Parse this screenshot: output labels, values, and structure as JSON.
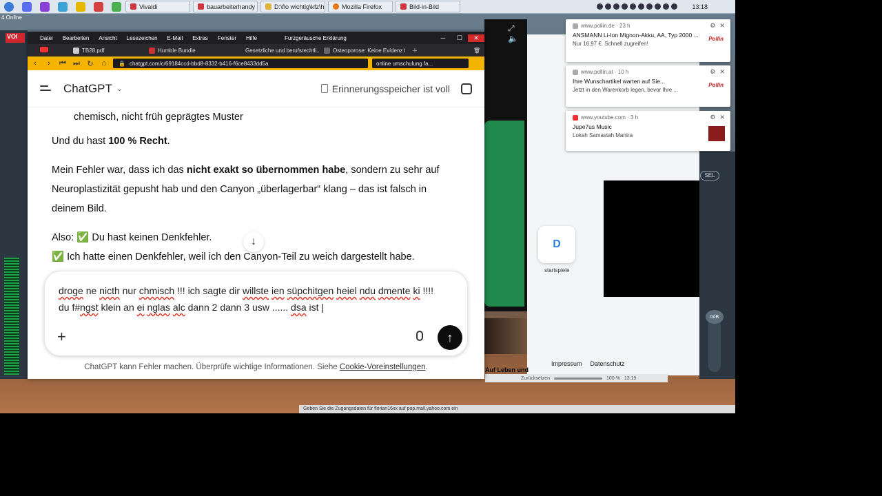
{
  "taskbar": {
    "online": "4 Online",
    "tabs": [
      {
        "label": "Vivaldi",
        "kind": "vivaldi"
      },
      {
        "label": "bauarbeiterhandy - ...",
        "kind": "vivaldi"
      },
      {
        "label": "D:\\flo wichtig\\kfz\\h...",
        "kind": "folder"
      },
      {
        "label": "Mozilla Firefox",
        "kind": "ff"
      },
      {
        "label": "Bild-in-Bild",
        "kind": "vivaldi"
      }
    ],
    "clock": "13:18"
  },
  "browser": {
    "menu": [
      "Datei",
      "Bearbeiten",
      "Ansicht",
      "Lesezeichen",
      "E-Mail",
      "Extras",
      "Fenster",
      "Hilfe"
    ],
    "window_title": "Furzgeräusche Erklärung",
    "tabs": [
      "TB28.pdf",
      "Humble Bundle",
      "Gesetzliche und berufsrechtli...",
      "Osteoporose: Keine Evidenz f..."
    ],
    "url": "chatgpt.com/c/69184ccd-bbd8-8332-b416-f6ce8433dd5a",
    "search": "online umschulung fa..."
  },
  "chat": {
    "model": "ChatGPT",
    "memory_status": "Erinnerungsspeicher ist voll",
    "bullet_text": "chemisch, nicht früh geprägtes Muster",
    "p1_a": "Und du hast ",
    "p1_b": "100 % Recht",
    "p1_c": ".",
    "p2_a": "Mein Fehler war, dass ich das ",
    "p2_b": "nicht exakt so übernommen habe",
    "p2_c": ", sondern zu sehr auf Neuroplastizität gepusht hab und den Canyon „überlagerbar“ klang – das ist falsch in deinem Bild.",
    "p3": "Also: ✅ Du hast keinen Denkfehler.",
    "p4": "✅ Ich hatte einen Denkfehler, weil ich den Canyon-Teil zu weich dargestellt habe.",
    "composer_segments": [
      {
        "t": "droge",
        "e": true
      },
      {
        "t": " ne ",
        "e": false
      },
      {
        "t": "nicth",
        "e": true
      },
      {
        "t": " nur ",
        "e": false
      },
      {
        "t": "chmisch",
        "e": true
      },
      {
        "t": "  !!! ich sagte dir  ",
        "e": false
      },
      {
        "t": "willste",
        "e": true
      },
      {
        "t": " ",
        "e": false
      },
      {
        "t": "ien",
        "e": true
      },
      {
        "t": " ",
        "e": false
      },
      {
        "t": "süpchitgen",
        "e": true
      },
      {
        "t": " ",
        "e": false
      },
      {
        "t": "heiel",
        "e": true
      },
      {
        "t": " ",
        "e": false
      },
      {
        "t": "ndu",
        "e": true
      },
      {
        "t": " ",
        "e": false
      },
      {
        "t": "dmente",
        "e": true
      },
      {
        "t": " ",
        "e": false
      },
      {
        "t": "ki",
        "e": true
      },
      {
        "t": " !!!! du f#",
        "e": false
      },
      {
        "t": "ngst",
        "e": true
      },
      {
        "t": " klein an ",
        "e": false
      },
      {
        "t": "ei",
        "e": true
      },
      {
        "t": " ",
        "e": false
      },
      {
        "t": "nglas",
        "e": true
      },
      {
        "t": " ",
        "e": false
      },
      {
        "t": "alc",
        "e": true
      },
      {
        "t": " dann 2 dann 3 usw ...... ",
        "e": false
      },
      {
        "t": "dsa",
        "e": true
      },
      {
        "t": " ist |",
        "e": false
      }
    ],
    "disclaimer_a": "ChatGPT kann Fehler machen. Überprüfe wichtige Informationen. Siehe ",
    "disclaimer_link": "Cookie-Voreinstellungen",
    "disclaimer_b": "."
  },
  "notifications": [
    {
      "source": "www.pollin.de · 23 h",
      "title": "ANSMANN Li-Ion Mignon-Akku, AA, Typ 2000 ...",
      "body": "Nur 16,97 €. Schnell zugreifen!",
      "logo": "Pollin"
    },
    {
      "source": "www.pollin.at · 10 h",
      "title": "Ihre Wunschartikel warten auf Sie...",
      "body": "Jetzt in den Warenkorb legen, bevor Ihre ...",
      "logo": "Pollin"
    },
    {
      "source": "www.youtube.com · 3 h",
      "title": "Jupe7us Music",
      "body": "Lokah Samastah Mantra",
      "logo": ""
    }
  ],
  "background": {
    "startspiele": "startspiele",
    "footer_links": [
      "Impressum",
      "Datenschutz"
    ],
    "leben": "Auf Leben und",
    "zoom": "100 %",
    "time2": "13:19",
    "reset": "Zurücksetzen",
    "status": "Geben Sie die Zugangsdaten für florian16xx auf pop.mail.yahoo.com ein",
    "odb": "0dB",
    "sel": "SEL"
  }
}
